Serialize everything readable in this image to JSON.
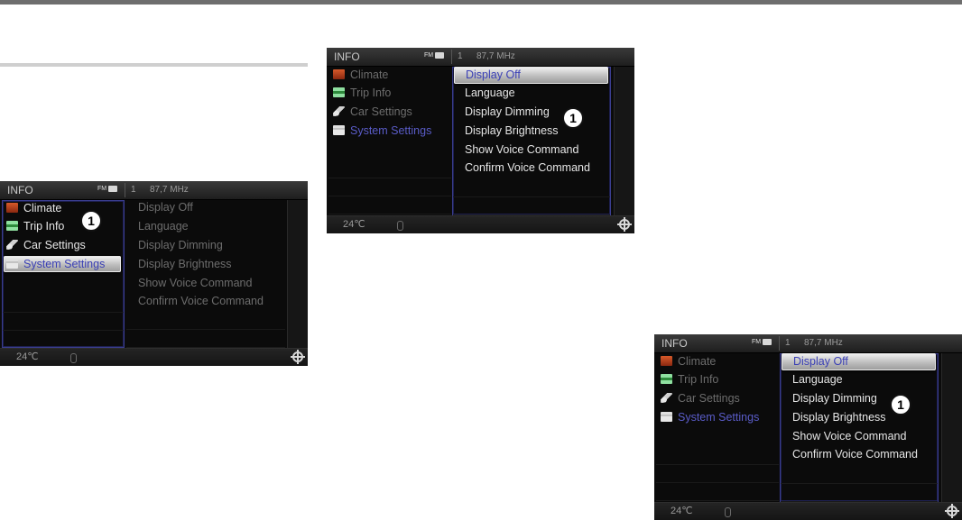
{
  "callout_label": "1",
  "screen": {
    "title": "INFO",
    "fm_badge": "FM",
    "radio_preset": "1",
    "radio_freq": "87,7 MHz",
    "temperature": "24℃",
    "left_menu": [
      {
        "label": "Climate",
        "icon": "climate-icon"
      },
      {
        "label": "Trip Info",
        "icon": "trip-info-icon"
      },
      {
        "label": "Car Settings",
        "icon": "car-settings-icon"
      },
      {
        "label": "System Settings",
        "icon": "system-settings-icon"
      }
    ],
    "right_menu": [
      {
        "label": "Display Off"
      },
      {
        "label": "Language"
      },
      {
        "label": "Display Dimming"
      },
      {
        "label": "Display Brightness"
      },
      {
        "label": "Show Voice Command"
      },
      {
        "label": "Confirm Voice Command"
      }
    ]
  },
  "colors": {
    "selection_text": "#3a3fb5",
    "focus_border": "#3a3d8f",
    "active_category_text": "#5a5cc8"
  }
}
